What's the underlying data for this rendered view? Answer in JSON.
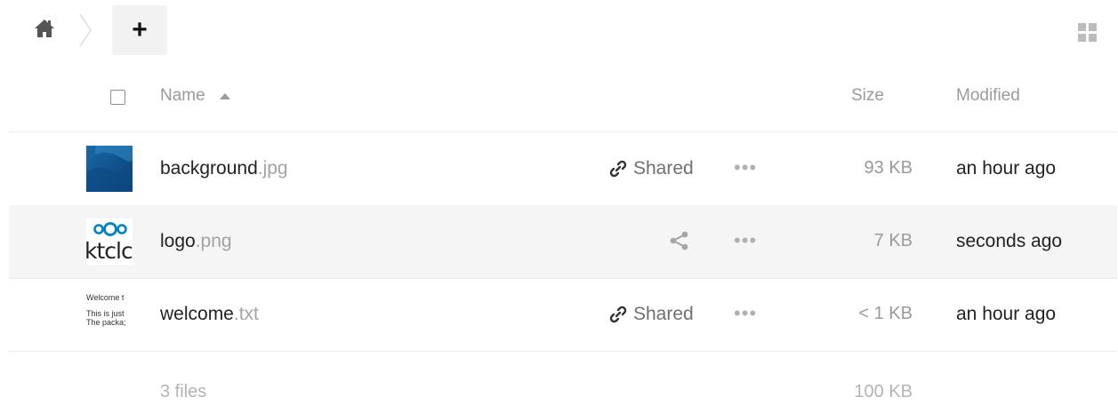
{
  "toolbar": {
    "home_icon": "home-icon",
    "add_label": "+",
    "view_toggle_icon": "grid-view-icon"
  },
  "columns": {
    "name": "Name",
    "size": "Size",
    "modified": "Modified"
  },
  "files": [
    {
      "basename": "background",
      "ext": ".jpg",
      "shared_label": "Shared",
      "size": "93 KB",
      "modified": "an hour ago"
    },
    {
      "basename": "logo",
      "ext": ".png",
      "shared_label": "",
      "size": "7 KB",
      "modified": "seconds ago"
    },
    {
      "basename": "welcome",
      "ext": ".txt",
      "shared_label": "Shared",
      "size": "< 1 KB",
      "modified": "an hour ago"
    }
  ],
  "thumbnails": {
    "logo_text": "ktclc",
    "welcome_lines": [
      "Welcome t",
      "This is just",
      "The packa;"
    ]
  },
  "more_label": "•••",
  "footer": {
    "count": "3 files",
    "total": "100 KB"
  },
  "colors": {
    "selected_row": "#f5f5f5",
    "nextcloud_blue": "#0082c9"
  }
}
